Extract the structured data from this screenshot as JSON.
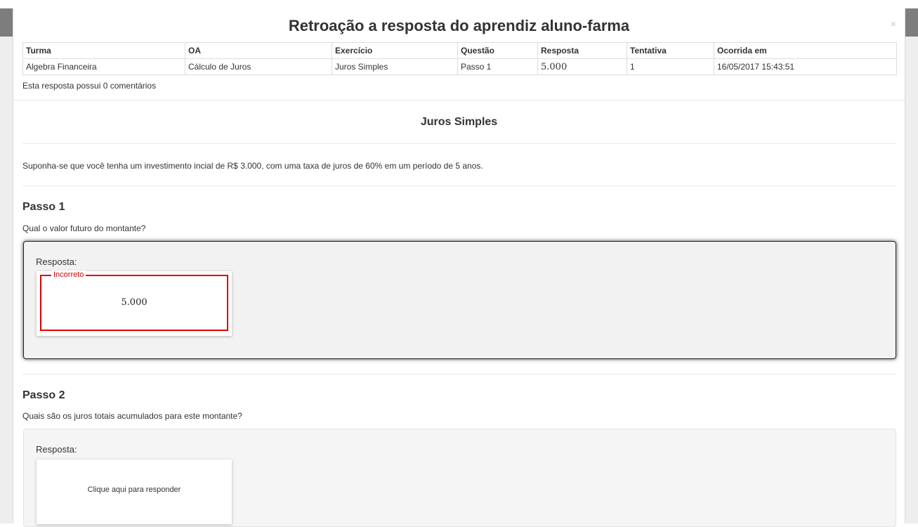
{
  "modal": {
    "title": "Retroação a resposta do aprendiz aluno-farma",
    "close_icon": "×"
  },
  "info_table": {
    "headers": [
      "Turma",
      "OA",
      "Exercício",
      "Questão",
      "Resposta",
      "Tentativa",
      "Ocorrida em"
    ],
    "row": [
      "Algebra Financeira",
      "Cálculo de Juros",
      "Juros Simples",
      "Passo 1",
      "5.000",
      "1",
      "16/05/2017 15:43:51"
    ]
  },
  "comment_count_text": "Esta resposta possui 0 comentários",
  "exercise": {
    "title": "Juros Simples",
    "statement": "Suponha-se que você tenha um investimento incial de R$ 3.000, com uma taxa de juros de 60% em um período de 5 anos."
  },
  "steps": [
    {
      "title": "Passo 1",
      "question": "Qual o valor futuro do montante?",
      "answer_label": "Resposta:",
      "status_label": "Incorreto",
      "answer_value": "5.000"
    },
    {
      "title": "Passo 2",
      "question": "Quais são os juros totais acumulados para este montante?",
      "answer_label": "Resposta:",
      "placeholder": "Clique aqui para responder"
    }
  ],
  "colors": {
    "incorrect": "#e00000",
    "panel_bg": "#f2f2f2",
    "backdrop": "#7d7d7d"
  }
}
